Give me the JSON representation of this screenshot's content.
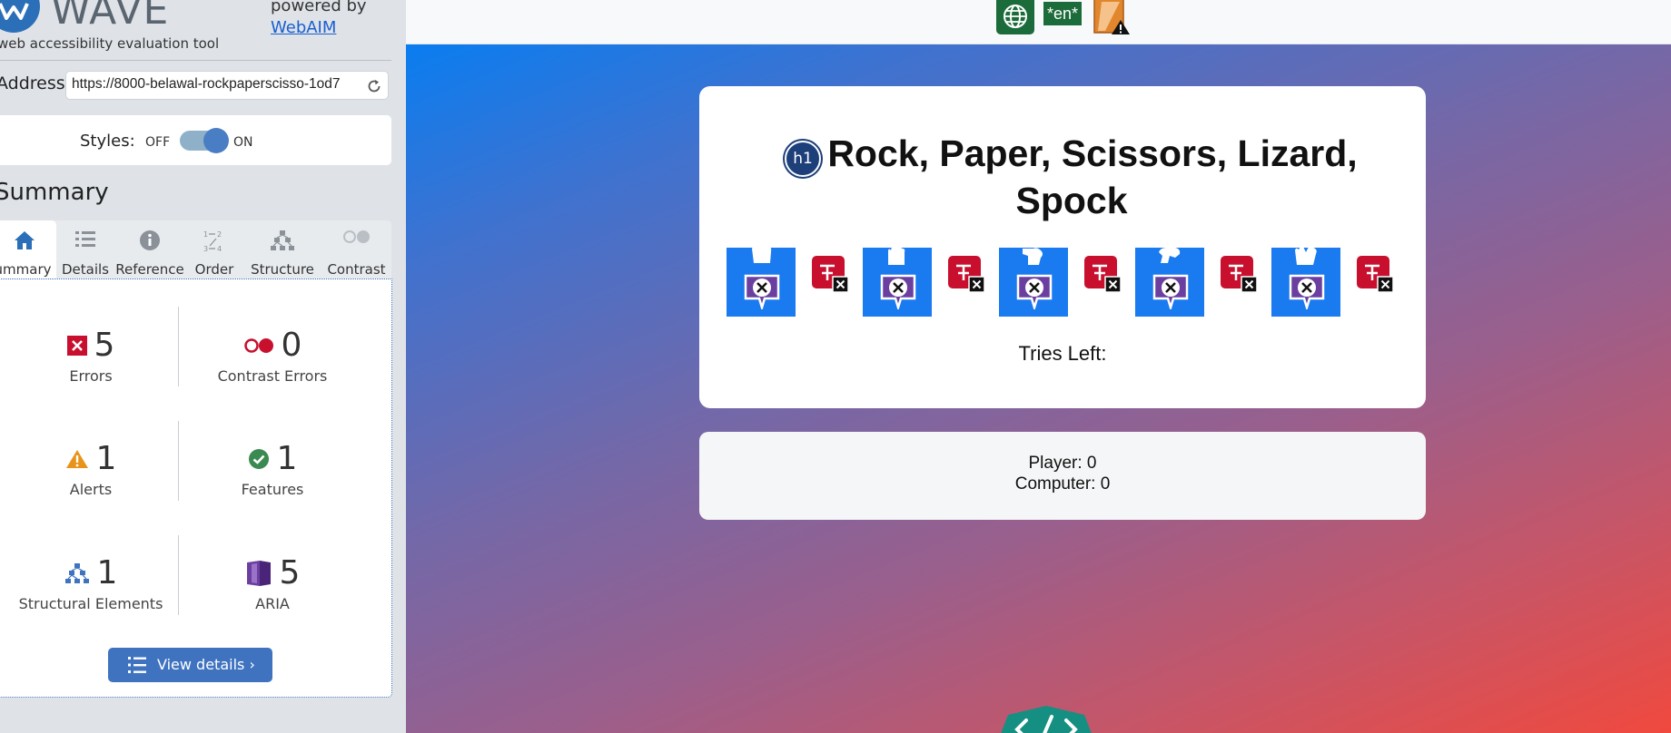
{
  "wave": {
    "logo_text": "WAVE",
    "tagline": "web accessibility evaluation tool",
    "powered_by": "powered by",
    "webaim_link": "WebAIM",
    "address_label": "Address:",
    "address_value": "https://8000-belawal-rockpaperscisso-1od7",
    "styles_label": "Styles:",
    "styles_off": "OFF",
    "styles_on": "ON",
    "summary_title": "Summary",
    "tabs": [
      {
        "label": "Summary",
        "icon": "home-icon",
        "active": true
      },
      {
        "label": "Details",
        "icon": "list-icon"
      },
      {
        "label": "Reference",
        "icon": "info-icon"
      },
      {
        "label": "Order",
        "icon": "order-icon"
      },
      {
        "label": "Structure",
        "icon": "structure-icon"
      },
      {
        "label": "Contrast",
        "icon": "contrast-icon"
      }
    ],
    "stats": {
      "errors": {
        "count": "5",
        "label": "Errors"
      },
      "contrast_errors": {
        "count": "0",
        "label": "Contrast Errors"
      },
      "alerts": {
        "count": "1",
        "label": "Alerts"
      },
      "features": {
        "count": "1",
        "label": "Features"
      },
      "structural": {
        "count": "1",
        "label": "Structural Elements"
      },
      "aria": {
        "count": "5",
        "label": "ARIA"
      }
    },
    "view_details": "View details ›"
  },
  "toolbar": {
    "lang_badge": "*en*"
  },
  "game": {
    "h1_badge": "h1",
    "title": "Rock, Paper, Scissors, Lizard, Spock",
    "choices": [
      "rock-icon",
      "paper-icon",
      "scissors-icon",
      "lizard-icon",
      "spock-icon"
    ],
    "tries_left": "Tries Left:",
    "player_score": "Player: 0",
    "computer_score": "Computer: 0"
  },
  "colors": {
    "wave_blue": "#3f73c0",
    "error_red": "#c8102e",
    "gradient_start": "#0a7df0",
    "gradient_end": "#f0493e"
  }
}
